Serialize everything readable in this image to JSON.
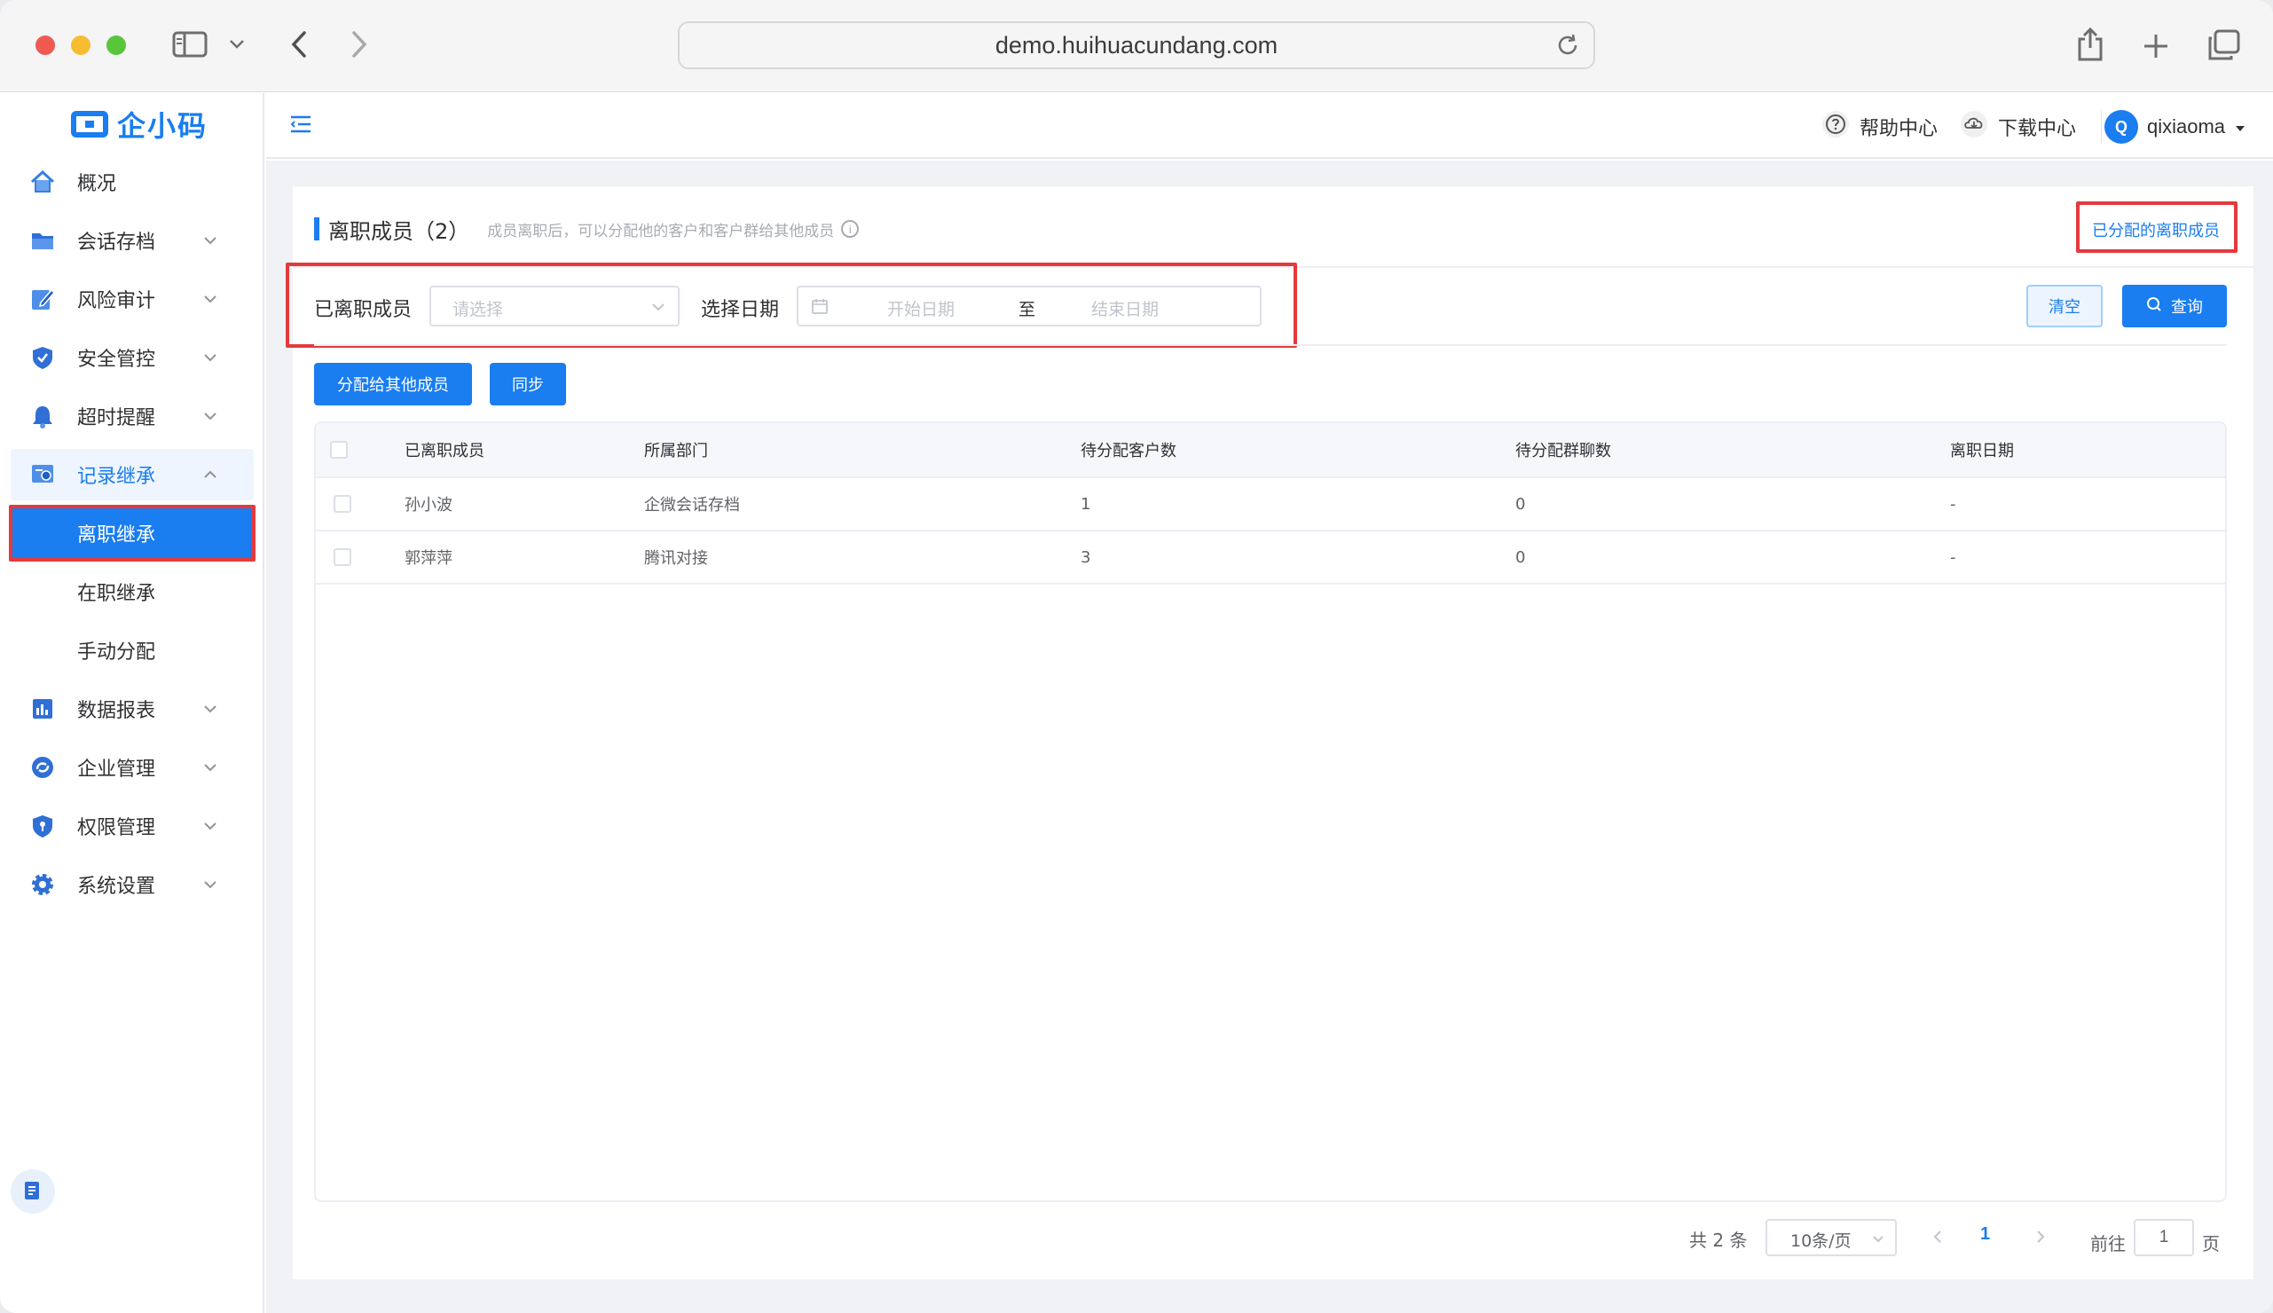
{
  "browser": {
    "url": "demo.huihuacundang.com"
  },
  "brand": {
    "logo_text": "企小码",
    "accent": "#1a7df0",
    "highlight_frame": "#e43a3d"
  },
  "sidebar": {
    "items": [
      {
        "label": "概况",
        "icon": "home-icon"
      },
      {
        "label": "会话存档",
        "icon": "folder-icon"
      },
      {
        "label": "风险审计",
        "icon": "edit-icon"
      },
      {
        "label": "安全管控",
        "icon": "shield-icon"
      },
      {
        "label": "超时提醒",
        "icon": "bell-icon"
      },
      {
        "label": "记录继承",
        "icon": "record-icon"
      },
      {
        "label": "数据报表",
        "icon": "chart-icon"
      },
      {
        "label": "企业管理",
        "icon": "org-icon"
      },
      {
        "label": "权限管理",
        "icon": "lock-shield-icon"
      },
      {
        "label": "系统设置",
        "icon": "gear-icon"
      }
    ],
    "subitems": [
      {
        "label": "离职继承"
      },
      {
        "label": "在职继承"
      },
      {
        "label": "手动分配"
      }
    ]
  },
  "header": {
    "help_label": "帮助中心",
    "download_label": "下载中心",
    "avatar_letter": "Q",
    "username": "qixiaoma"
  },
  "page": {
    "title": "离职成员（2）",
    "subtitle": "成员离职后，可以分配他的客户和客户群给其他成员",
    "info_glyph": "i",
    "assigned_link": "已分配的离职成员"
  },
  "filters": {
    "member_label": "已离职成员",
    "member_placeholder": "请选择",
    "date_label": "选择日期",
    "start_placeholder": "开始日期",
    "range_separator": "至",
    "end_placeholder": "结束日期",
    "clear_label": "清空",
    "query_label": "查询"
  },
  "actions": {
    "assign_label": "分配给其他成员",
    "sync_label": "同步"
  },
  "table": {
    "headers": [
      "已离职成员",
      "所属部门",
      "待分配客户数",
      "待分配群聊数",
      "离职日期"
    ],
    "rows": [
      [
        "孙小波",
        "企微会话存档",
        "1",
        "0",
        "-"
      ],
      [
        "郭萍萍",
        "腾讯对接",
        "3",
        "0",
        "-"
      ]
    ]
  },
  "pagination": {
    "total": "共 2 条",
    "page_size": "10条/页",
    "current_page": "1",
    "goto_prefix": "前往",
    "goto_value": "1",
    "goto_suffix": "页"
  }
}
